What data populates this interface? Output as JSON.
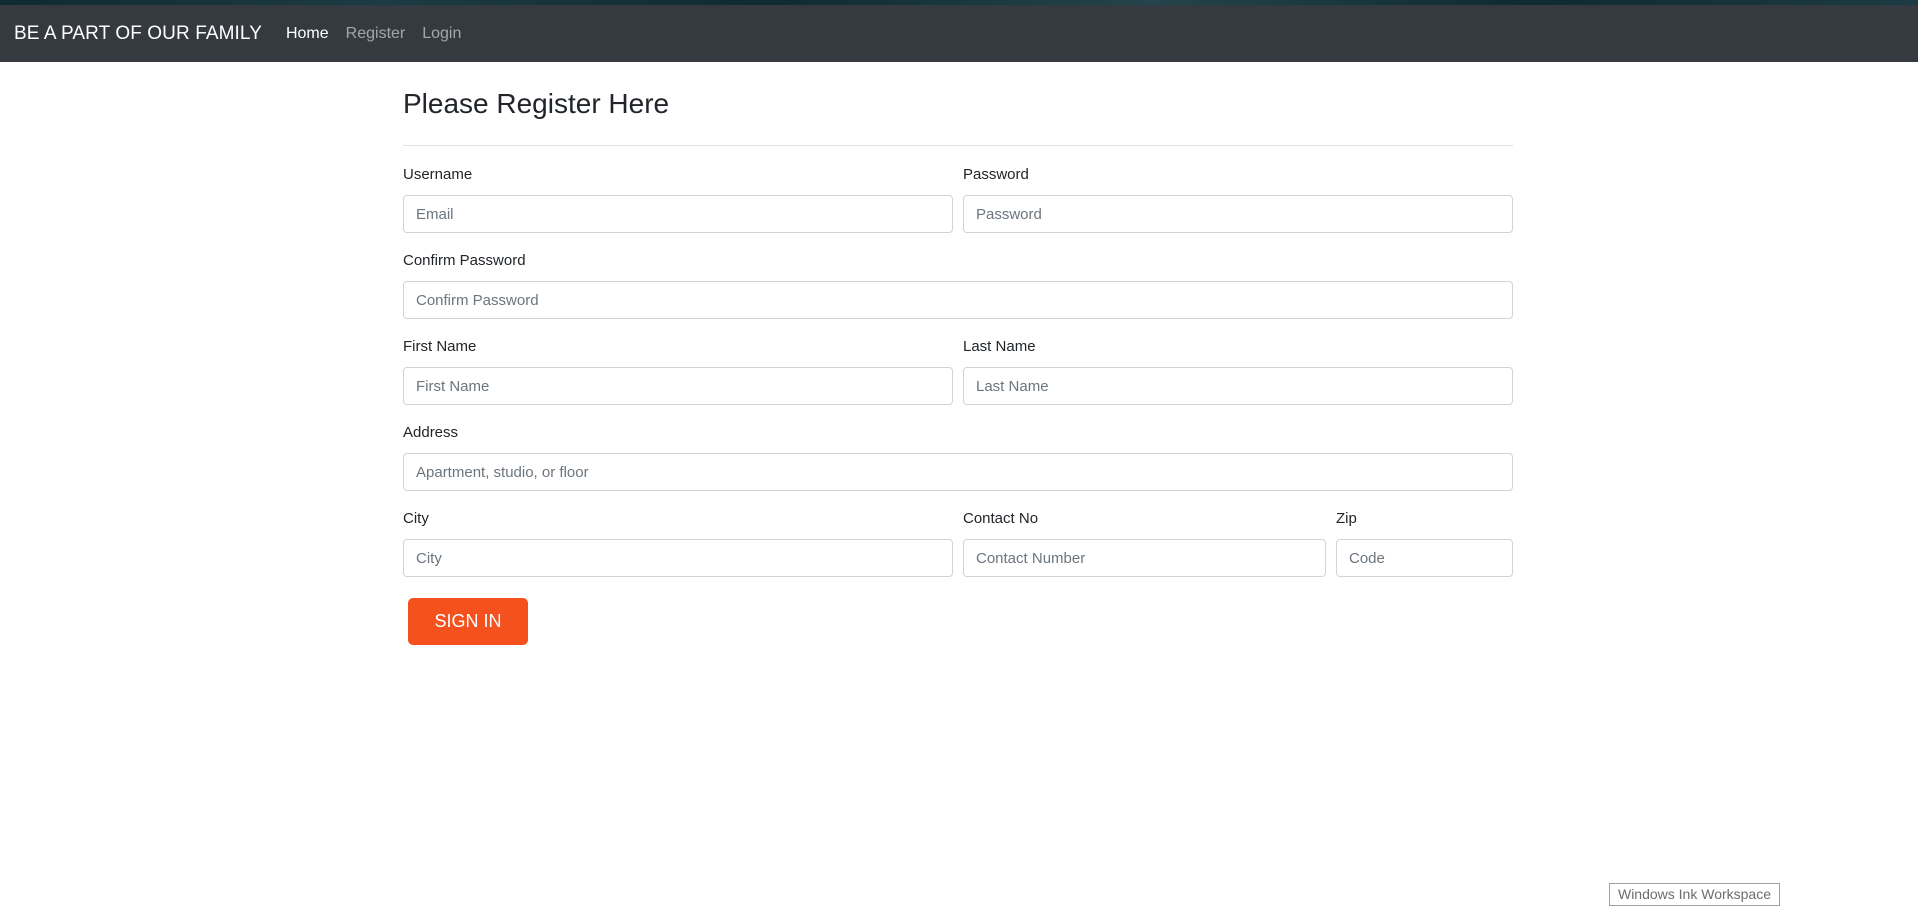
{
  "navbar": {
    "brand": "BE A PART OF OUR FAMILY",
    "links": [
      {
        "label": "Home",
        "active": true
      },
      {
        "label": "Register",
        "active": false
      },
      {
        "label": "Login",
        "active": false
      }
    ]
  },
  "form": {
    "title": "Please Register Here",
    "username": {
      "label": "Username",
      "placeholder": "Email"
    },
    "password": {
      "label": "Password",
      "placeholder": "Password"
    },
    "confirm_password": {
      "label": "Confirm Password",
      "placeholder": "Confirm Password"
    },
    "first_name": {
      "label": "First Name",
      "placeholder": "First Name"
    },
    "last_name": {
      "label": "Last Name",
      "placeholder": "Last Name"
    },
    "address": {
      "label": "Address",
      "placeholder": "Apartment, studio, or floor"
    },
    "city": {
      "label": "City",
      "placeholder": "City"
    },
    "contact": {
      "label": "Contact No",
      "placeholder": "Contact Number"
    },
    "zip": {
      "label": "Zip",
      "placeholder": "Code"
    },
    "submit_label": "SIGN IN"
  },
  "taskbar": {
    "ink_workspace": "Windows Ink Workspace"
  },
  "colors": {
    "navbar_bg": "#343a40",
    "button_bg": "#f4511e"
  }
}
